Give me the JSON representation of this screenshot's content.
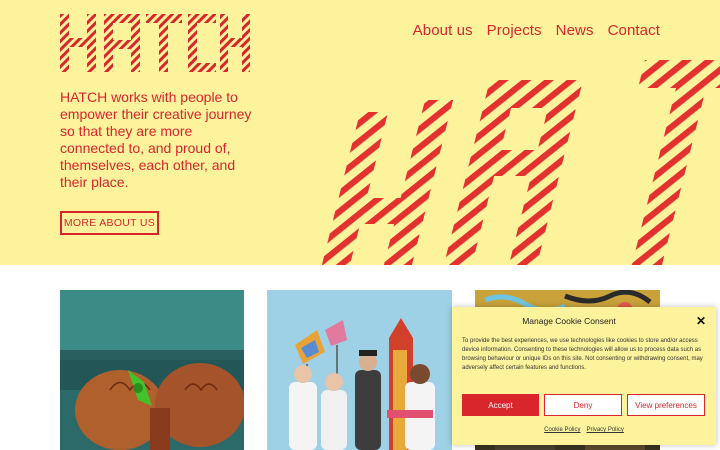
{
  "brand": {
    "logo_text": "HATCH",
    "accent": "#d8262c",
    "background": "#fdf39d"
  },
  "nav": {
    "items": [
      "About us",
      "Projects",
      "News",
      "Contact"
    ]
  },
  "hero": {
    "tagline": "HATCH works with people to empower their creative journey so that they are more connected to, and proud of, themselves, each other, and their place.",
    "cta": "MORE ABOUT US"
  },
  "cards": [
    {
      "image": "hands-painting-photo"
    },
    {
      "image": "costumed-performers-photo"
    },
    {
      "image": "graffiti-collage-photo"
    }
  ],
  "cookie": {
    "title": "Manage Cookie Consent",
    "text": "To provide the best experiences, we use technologies like cookies to store and/or access device information. Consenting to these technologies will allow us to process data such as browsing behaviour or unique IDs on this site. Not consenting or withdrawing consent, may adversely affect certain features and functions.",
    "accept": "Accept",
    "deny": "Deny",
    "view": "View preferences",
    "links": [
      "Cookie Policy",
      "Privacy Policy"
    ]
  }
}
